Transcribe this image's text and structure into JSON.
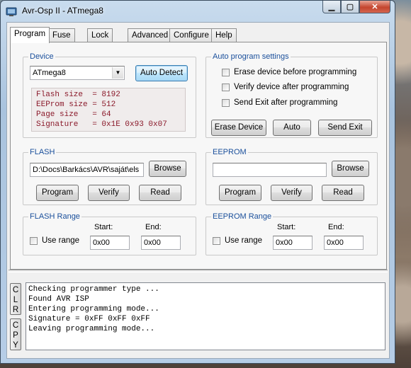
{
  "window": {
    "title": "Avr-Osp II - ATmega8",
    "min": "▁",
    "max": "▢",
    "close": "✕"
  },
  "tabs": [
    "Program",
    "Fuse Bits",
    "Lock Bits",
    "Advanced",
    "Configure",
    "Help"
  ],
  "device": {
    "label": "Device",
    "selected": "ATmega8",
    "auto_detect": "Auto Detect",
    "info": [
      "Flash size  = 8192",
      "EEProm size = 512",
      "Page size   = 64",
      "Signature   = 0x1E 0x93 0x07"
    ]
  },
  "auto": {
    "label": "Auto program settings",
    "options": [
      "Erase device before programming",
      "Verify device after programming",
      "Send Exit after programming"
    ],
    "erase": "Erase Device",
    "auto": "Auto",
    "send_exit": "Send Exit"
  },
  "flash": {
    "label": "FLASH",
    "path": "D:\\Docs\\Barkács\\AVR\\saját\\els",
    "browse": "Browse",
    "program": "Program",
    "verify": "Verify",
    "read": "Read"
  },
  "eeprom": {
    "label": "EEPROM",
    "path": "",
    "browse": "Browse",
    "program": "Program",
    "verify": "Verify",
    "read": "Read"
  },
  "flash_range": {
    "label": "FLASH Range",
    "use": "Use range",
    "start_label": "Start:",
    "end_label": "End:",
    "start": "0x00",
    "end": "0x00"
  },
  "eeprom_range": {
    "label": "EEPROM Range",
    "use": "Use range",
    "start_label": "Start:",
    "end_label": "End:",
    "start": "0x00",
    "end": "0x00"
  },
  "side": {
    "clr": [
      "C",
      "L",
      "R"
    ],
    "cpy": [
      "C",
      "P",
      "Y"
    ]
  },
  "log": [
    "Checking programmer type ...",
    "Found AVR ISP",
    "Entering programming mode...",
    "Signature = 0xFF 0xFF 0xFF",
    "Leaving programming mode..."
  ]
}
